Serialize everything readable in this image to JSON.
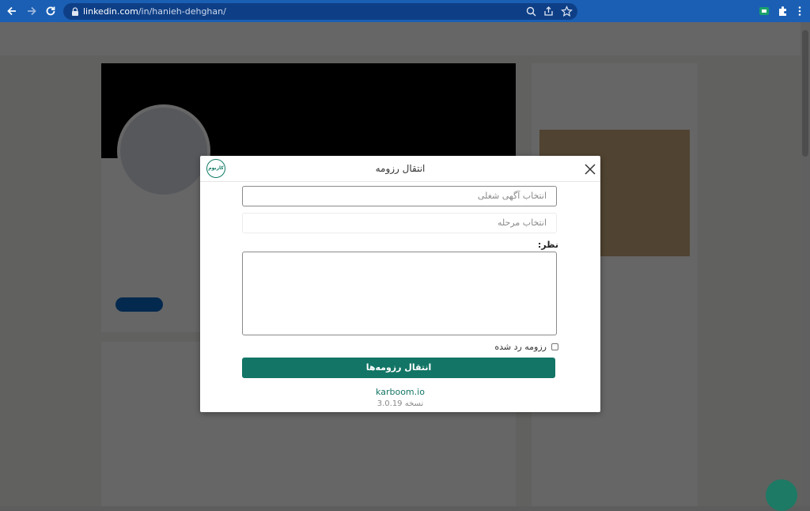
{
  "browser": {
    "url_domain": "linkedin.com",
    "url_path": "/in/hanieh-dehghan/",
    "icons": [
      "back-icon",
      "forward-icon",
      "reload-icon",
      "lock-icon",
      "zoom-icon",
      "share-icon",
      "star-icon",
      "extension-icon",
      "puzzle-icon",
      "menu-icon"
    ]
  },
  "modal": {
    "title": "انتقال رزومه",
    "logo_text": "کاربوم",
    "job_select_placeholder": "انتخاب آگهی شغلی",
    "stage_select_placeholder": "انتخاب مرحله",
    "comment_label": "نظر:",
    "comment_value": "",
    "rejected_checkbox_label": "رزومه رد شده",
    "rejected_checked": false,
    "submit_label": "انتقال رزومه‌ها",
    "link_text": "karboom.io",
    "version_text": "نسخه 3.0.19"
  },
  "colors": {
    "brand": "#137566",
    "chrome": "#1a5fb4"
  }
}
